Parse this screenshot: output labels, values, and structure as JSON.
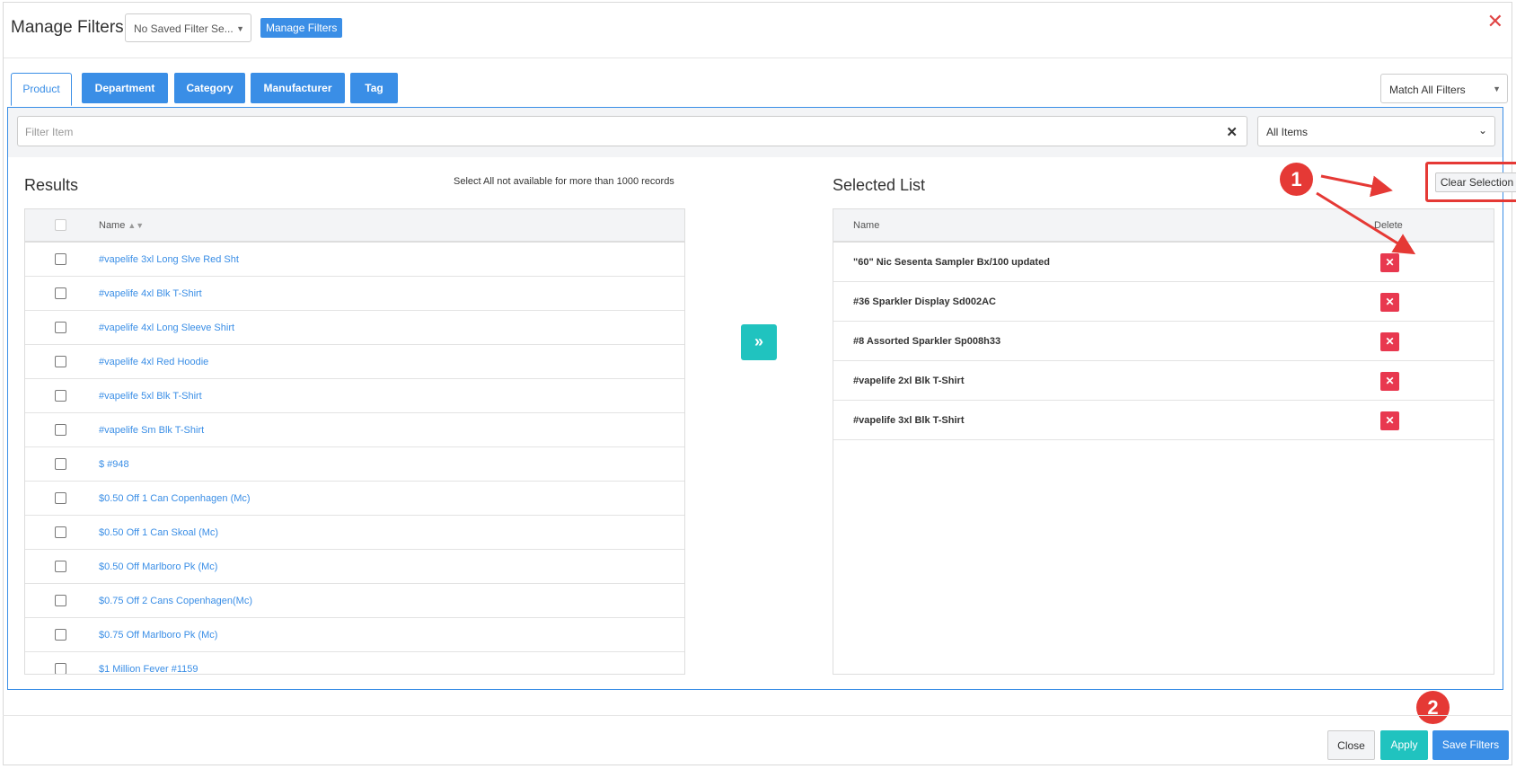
{
  "header": {
    "title": "Manage Filters",
    "saved_filter": "No Saved Filter Se...",
    "manage_button": "Manage Filters",
    "close_glyph": "✕"
  },
  "tabs": [
    {
      "label": "Product",
      "active": true
    },
    {
      "label": "Department",
      "active": false
    },
    {
      "label": "Category",
      "active": false
    },
    {
      "label": "Manufacturer",
      "active": false
    },
    {
      "label": "Tag",
      "active": false
    }
  ],
  "match_select": {
    "value": "Match All Filters"
  },
  "filter": {
    "placeholder": "Filter Item",
    "scope_select": "All Items"
  },
  "results": {
    "title": "Results",
    "note": "Select All not available for more than 1000 records",
    "column_name": "Name",
    "items": [
      "#vapelife 3xl Long Slve Red Sht",
      "#vapelife 4xl Blk T-Shirt",
      "#vapelife 4xl Long Sleeve Shirt",
      "#vapelife 4xl Red Hoodie",
      "#vapelife 5xl Blk T-Shirt",
      "#vapelife Sm Blk T-Shirt",
      "$ #948",
      "$0.50 Off 1 Can Copenhagen (Mc)",
      "$0.50 Off 1 Can Skoal (Mc)",
      "$0.50 Off Marlboro Pk (Mc)",
      "$0.75 Off 2 Cans Copenhagen(Mc)",
      "$0.75 Off Marlboro Pk (Mc)",
      "$1 Million Fever #1159"
    ]
  },
  "selected": {
    "title": "Selected List",
    "clear_button": "Clear Selection",
    "column_name": "Name",
    "column_delete": "Delete",
    "items": [
      "\"60\" Nic Sesenta Sampler Bx/100 updated",
      "#36 Sparkler Display Sd002AC",
      "#8 Assorted Sparkler Sp008h33",
      "#vapelife 2xl Blk T-Shirt",
      "#vapelife 3xl Blk T-Shirt"
    ]
  },
  "callouts": {
    "one": "1",
    "two": "2"
  },
  "footer": {
    "close": "Close",
    "apply": "Apply",
    "save": "Save Filters"
  },
  "colors": {
    "primary": "#3a8ee6",
    "teal": "#20c3bf",
    "danger": "#e8384f",
    "annotation": "#e53935"
  }
}
